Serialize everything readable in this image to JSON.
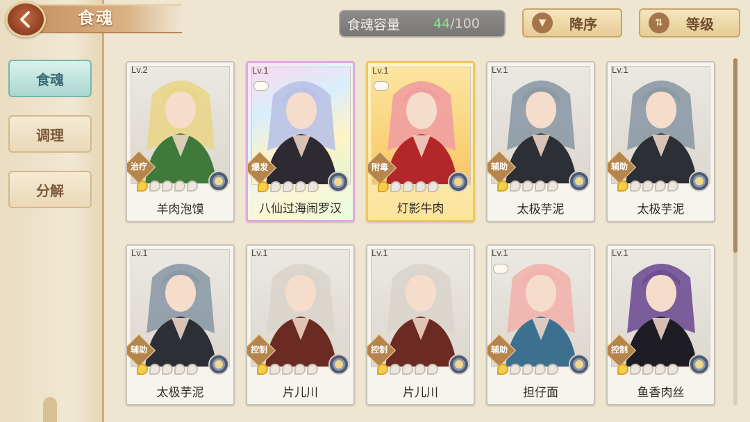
{
  "header": {
    "title": "食魂"
  },
  "sidebar": {
    "tabs": [
      {
        "label": "食魂"
      },
      {
        "label": "调理"
      },
      {
        "label": "分解"
      }
    ]
  },
  "capacity": {
    "label": "食魂容量",
    "current": "44",
    "separator": "/",
    "max": "100"
  },
  "sort": {
    "order_label": "降序",
    "order_icon": "triangle-down-icon",
    "field_label": "等级",
    "field_icon": "sort-arrows-icon"
  },
  "colors": {
    "accent_teal": "#a9d8cf",
    "capacity_current": "#8ee08f",
    "rainbow_frame": "#e3a7e6",
    "gold_frame": "#efc760"
  },
  "cards": [
    {
      "level": "Lv.2",
      "role": "治疗",
      "name": "羊肉泡馍",
      "stars_filled": 1,
      "stars_total": 5,
      "frame": "normal",
      "bubble": false,
      "hair": "#e9d58a",
      "outfit": "#3f7a3a"
    },
    {
      "level": "Lv.1",
      "role": "爆发",
      "name": "八仙过海闹罗汉",
      "stars_filled": 1,
      "stars_total": 5,
      "frame": "rainbow",
      "bubble": true,
      "hair": "#b9c2e6",
      "outfit": "#2d2a33"
    },
    {
      "level": "Lv.1",
      "role": "附毒",
      "name": "灯影牛肉",
      "stars_filled": 1,
      "stars_total": 5,
      "frame": "gold",
      "bubble": true,
      "hair": "#ef9fa0",
      "outfit": "#b3262a"
    },
    {
      "level": "Lv.1",
      "role": "辅助",
      "name": "太极芋泥",
      "stars_filled": 1,
      "stars_total": 5,
      "frame": "normal",
      "bubble": false,
      "hair": "#8c9aa6",
      "outfit": "#2c2f36"
    },
    {
      "level": "Lv.1",
      "role": "辅助",
      "name": "太极芋泥",
      "stars_filled": 1,
      "stars_total": 5,
      "frame": "normal",
      "bubble": false,
      "hair": "#8c9aa6",
      "outfit": "#2c2f36"
    },
    {
      "level": "Lv.1",
      "role": "辅助",
      "name": "太极芋泥",
      "stars_filled": 1,
      "stars_total": 5,
      "frame": "normal",
      "bubble": false,
      "hair": "#8c9aa6",
      "outfit": "#2c2f36"
    },
    {
      "level": "Lv.1",
      "role": "控制",
      "name": "片儿川",
      "stars_filled": 1,
      "stars_total": 5,
      "frame": "normal",
      "bubble": false,
      "hair": "#d9d4cc",
      "outfit": "#6b2a22"
    },
    {
      "level": "Lv.1",
      "role": "控制",
      "name": "片儿川",
      "stars_filled": 1,
      "stars_total": 5,
      "frame": "normal",
      "bubble": false,
      "hair": "#d9d4cc",
      "outfit": "#6b2a22"
    },
    {
      "level": "Lv.1",
      "role": "辅助",
      "name": "担仔面",
      "stars_filled": 1,
      "stars_total": 5,
      "frame": "normal",
      "bubble": true,
      "hair": "#f2b2ad",
      "outfit": "#3d6f8f"
    },
    {
      "level": "Lv.1",
      "role": "控制",
      "name": "鱼香肉丝",
      "stars_filled": 1,
      "stars_total": 5,
      "frame": "normal",
      "bubble": false,
      "hair": "#6f4f94",
      "outfit": "#1f1d24"
    }
  ]
}
